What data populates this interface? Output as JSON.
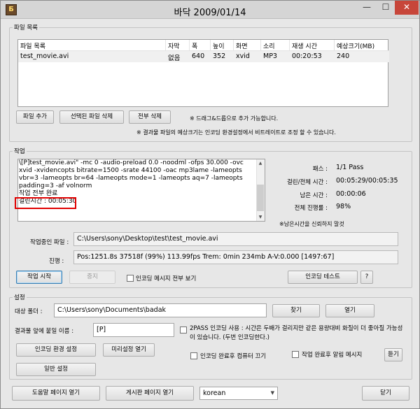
{
  "window": {
    "title": "바닥 2009/01/14",
    "min": "—",
    "max": "☐",
    "close": "✕",
    "app_icon": "Б"
  },
  "file_list": {
    "legend": "파일 목록",
    "columns": [
      "파일 목록",
      "자막",
      "폭",
      "높이",
      "화면",
      "소리",
      "재생 시간",
      "예상크기(MB)"
    ],
    "rows": [
      {
        "file": "test_movie.avi",
        "subtitle": "없음",
        "width": "640",
        "height": "352",
        "video": "xvid",
        "audio": "MP3",
        "duration": "00:20:53",
        "size": "240"
      }
    ],
    "add_file": "파일 추가",
    "delete_selected": "선택된 파일 삭제",
    "delete_all": "전부 삭제",
    "drag_note": "※ 드래그&드롭으로 추가 가능합니다.",
    "size_note": "※ 결과물 파일의 예상크기는 인코딩 환경설정에서 비트레이트로 조정 할 수 있습니다."
  },
  "job": {
    "legend": "작업",
    "log_text": "\\[P]test_movie.avi\" -mc 0 -audio-preload 0.0 -noodml -ofps 30.000 -ovc xvid -xvidencopts bitrate=1500 -srate 44100 -oac mp3lame -lameopts vbr=3 -lameopts br=64 -lameopts mode=1 -lameopts aq=7 -lameopts padding=3 -af volnorm\n작업 전부 완료\n걸린시간 : 00:05:30",
    "pass_label": "패스 :",
    "pass_value": "1/1 Pass",
    "elapsed_label": "걸린/전체 시간 :",
    "elapsed_value": "00:05:29/00:05:35",
    "remaining_label": "남은 시간 :",
    "remaining_value": "00:00:06",
    "progress_label": "전체 진행률 :",
    "progress_value": "98%",
    "trust_note": "※남은시간을 신뢰하지 말것",
    "current_file_label": "작업중인 파일 :",
    "current_file": "C:\\Users\\sony\\Desktop\\test\\test_movie.avi",
    "status_label": "진행 :",
    "status": "Pos:1251.8s  37518f (99%) 113.99fps Trem:    0min 234mb  A-V:0.000 [1497:67]",
    "start": "작업 시작",
    "stop": "중지",
    "show_all_msgs": "인코딩 메시지 전부 보기",
    "encode_test": "인코딩 테스트",
    "help": "?"
  },
  "settings": {
    "legend": "설정",
    "target_folder_label": "대상 폴더 :",
    "target_folder": "C:\\Users\\sony\\Documents\\badak",
    "browse": "찾기",
    "open": "열기",
    "prefix_label": "결과물 앞에 붙일 이름 :",
    "prefix": "[P]",
    "two_pass_text": "2PASS 인코딩 사용 : 시간은 두배가 걸리지만 같은 용량대비 화질이 더 좋아질 가능성이 있습니다. (두번 인코딩한다.)",
    "encode_env": "인코딩 환경 설정",
    "preset_open": "미리설정 열기",
    "shutdown_after": "인코딩 완료후 컴퓨터 끄기",
    "alert_after": "작업 완료후 알림 메시지",
    "listen": "듣기",
    "general": "일반 설정"
  },
  "footer": {
    "help_page": "도움말 페이지 열기",
    "board_page": "게시판 페이지 열기",
    "language": "korean",
    "close": "닫기"
  }
}
